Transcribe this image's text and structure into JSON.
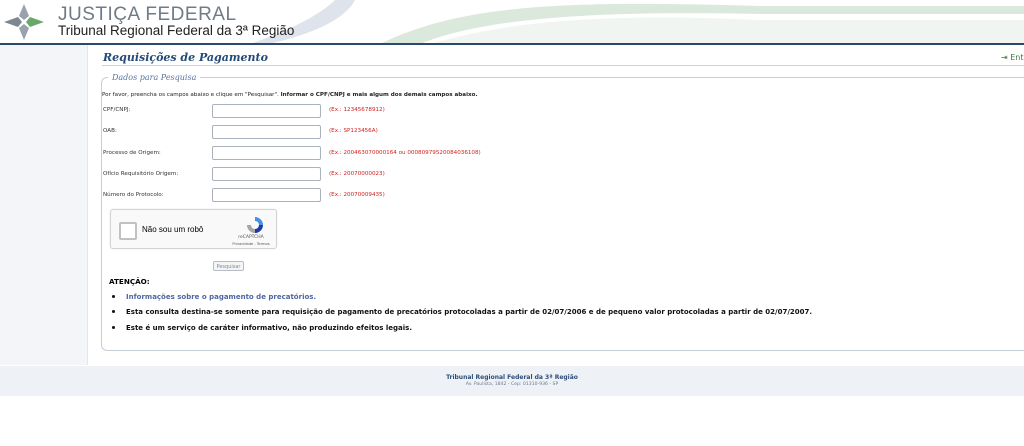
{
  "header": {
    "brand": "JUSTIÇA FEDERAL",
    "subtitle": "Tribunal Regional Federal da 3ª Região"
  },
  "page": {
    "title": "Requisições de Pagamento",
    "exit_label": "Ent"
  },
  "form": {
    "legend": "Dados para Pesquisa",
    "intro_normal": "Por favor, preencha os campos abaixo e clique em \"Pesquisar\". ",
    "intro_bold": "Informar o CPF/CNPJ e mais algum dos demais campos abaixo.",
    "fields": [
      {
        "label": "CPF/CNPJ:",
        "value": "",
        "example": "(Ex.: 12345678912)"
      },
      {
        "label": "OAB:",
        "value": "",
        "example": "(Ex.: SP123456A)"
      },
      {
        "label": "Processo de Origem:",
        "value": "",
        "example": "(Ex.: 200463070000164 ou 00080979520084036108)"
      },
      {
        "label": "Ofício Requisitório Origem:",
        "value": "",
        "example": "(Ex.: 20070000023)"
      },
      {
        "label": "Número do Protocolo:",
        "value": "",
        "example": "(Ex.: 20070009435)"
      }
    ],
    "captcha": {
      "label": "Não sou um robô",
      "brand": "reCAPTCHA",
      "links": "Privacidade - Termos"
    },
    "search_button": "Pesquisar"
  },
  "attention": {
    "title": "ATENÇÃO:",
    "items": [
      "Informações sobre o pagamento de precatórios.",
      "Esta consulta destina-se somente para requisição de pagamento de precatórios protocoladas a partir de 02/07/2006 e de pequeno valor protocoladas a partir de 02/07/2007.",
      "Este é um serviço de caráter informativo, não produzindo efeitos legais."
    ]
  },
  "footer": {
    "line1": "Tribunal Regional Federal da 3ª Região",
    "line2": "Av. Paulista, 1842 - Cep: 01310-936 - SP"
  },
  "colors": {
    "header_line": "#2b4a6b",
    "title": "#234a77",
    "example_red": "#d02020",
    "link": "#5066a3"
  }
}
